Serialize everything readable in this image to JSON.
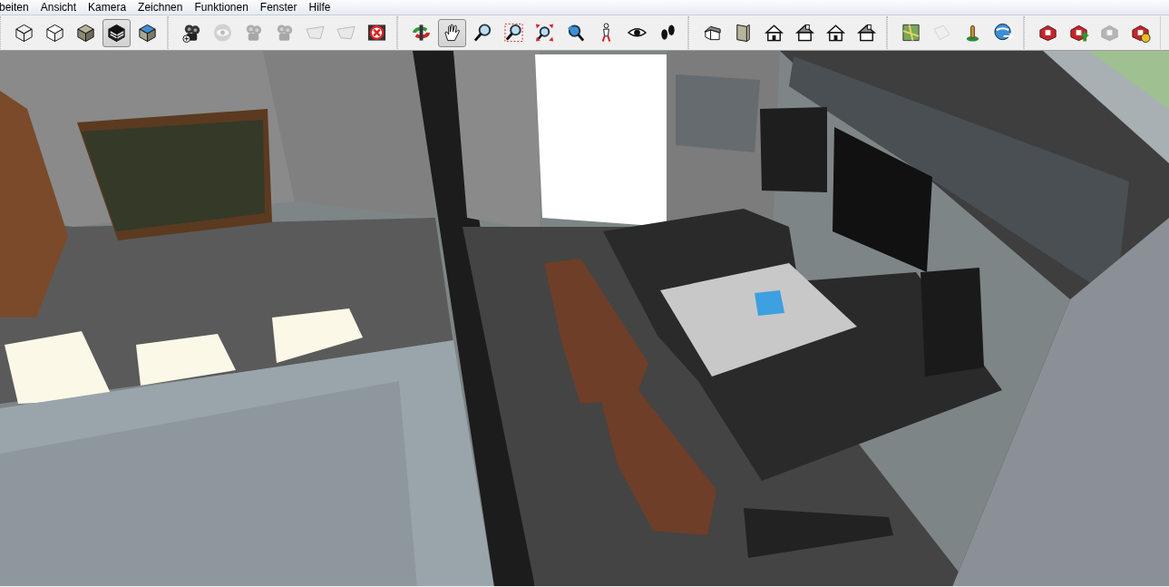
{
  "menu": [
    {
      "label": "beiten"
    },
    {
      "label": "Ansicht"
    },
    {
      "label": "Kamera"
    },
    {
      "label": "Zeichnen"
    },
    {
      "label": "Funktionen"
    },
    {
      "label": "Fenster"
    },
    {
      "label": "Hilfe"
    }
  ],
  "toolbars": [
    {
      "tools": [
        {
          "kind": "wireframe",
          "selected": false,
          "disabled": false
        },
        {
          "kind": "hidden-line",
          "selected": false,
          "disabled": false
        },
        {
          "kind": "shaded",
          "selected": false,
          "disabled": false
        },
        {
          "kind": "textured",
          "selected": true,
          "disabled": false
        },
        {
          "kind": "monochrome",
          "selected": false,
          "disabled": false
        }
      ]
    },
    {
      "tools": [
        {
          "kind": "add-camera",
          "selected": false,
          "disabled": false
        },
        {
          "kind": "eye-round",
          "selected": false,
          "disabled": true
        },
        {
          "kind": "camera",
          "selected": false,
          "disabled": true
        },
        {
          "kind": "camera",
          "selected": false,
          "disabled": true
        },
        {
          "kind": "plane",
          "selected": false,
          "disabled": true
        },
        {
          "kind": "plane",
          "selected": false,
          "disabled": true
        },
        {
          "kind": "cancel",
          "selected": false,
          "disabled": false
        }
      ]
    },
    {
      "tools": [
        {
          "kind": "orbit",
          "selected": false,
          "disabled": false
        },
        {
          "kind": "pan",
          "selected": true,
          "disabled": false
        },
        {
          "kind": "zoom",
          "selected": false,
          "disabled": false
        },
        {
          "kind": "zoom-window",
          "selected": false,
          "disabled": false
        },
        {
          "kind": "zoom-extents",
          "selected": false,
          "disabled": false
        },
        {
          "kind": "previous",
          "selected": false,
          "disabled": false
        },
        {
          "kind": "person",
          "selected": false,
          "disabled": false
        },
        {
          "kind": "eye",
          "selected": false,
          "disabled": false
        },
        {
          "kind": "walk",
          "selected": false,
          "disabled": false
        }
      ]
    },
    {
      "tools": [
        {
          "kind": "house-iso",
          "selected": false,
          "disabled": false
        },
        {
          "kind": "top",
          "selected": false,
          "disabled": false
        },
        {
          "kind": "house",
          "selected": false,
          "disabled": false
        },
        {
          "kind": "house-side",
          "selected": false,
          "disabled": false
        },
        {
          "kind": "house",
          "selected": false,
          "disabled": false
        },
        {
          "kind": "house-side",
          "selected": false,
          "disabled": false
        }
      ]
    },
    {
      "tools": [
        {
          "kind": "map",
          "selected": false,
          "disabled": false
        },
        {
          "kind": "pages",
          "selected": false,
          "disabled": true
        },
        {
          "kind": "pin",
          "selected": false,
          "disabled": false
        },
        {
          "kind": "globe",
          "selected": false,
          "disabled": false
        }
      ]
    },
    {
      "tools": [
        {
          "kind": "box",
          "selected": false,
          "disabled": false
        },
        {
          "kind": "box-upload",
          "selected": false,
          "disabled": false
        },
        {
          "kind": "box",
          "selected": false,
          "disabled": true
        },
        {
          "kind": "box-sync",
          "selected": false,
          "disabled": false
        }
      ]
    }
  ]
}
